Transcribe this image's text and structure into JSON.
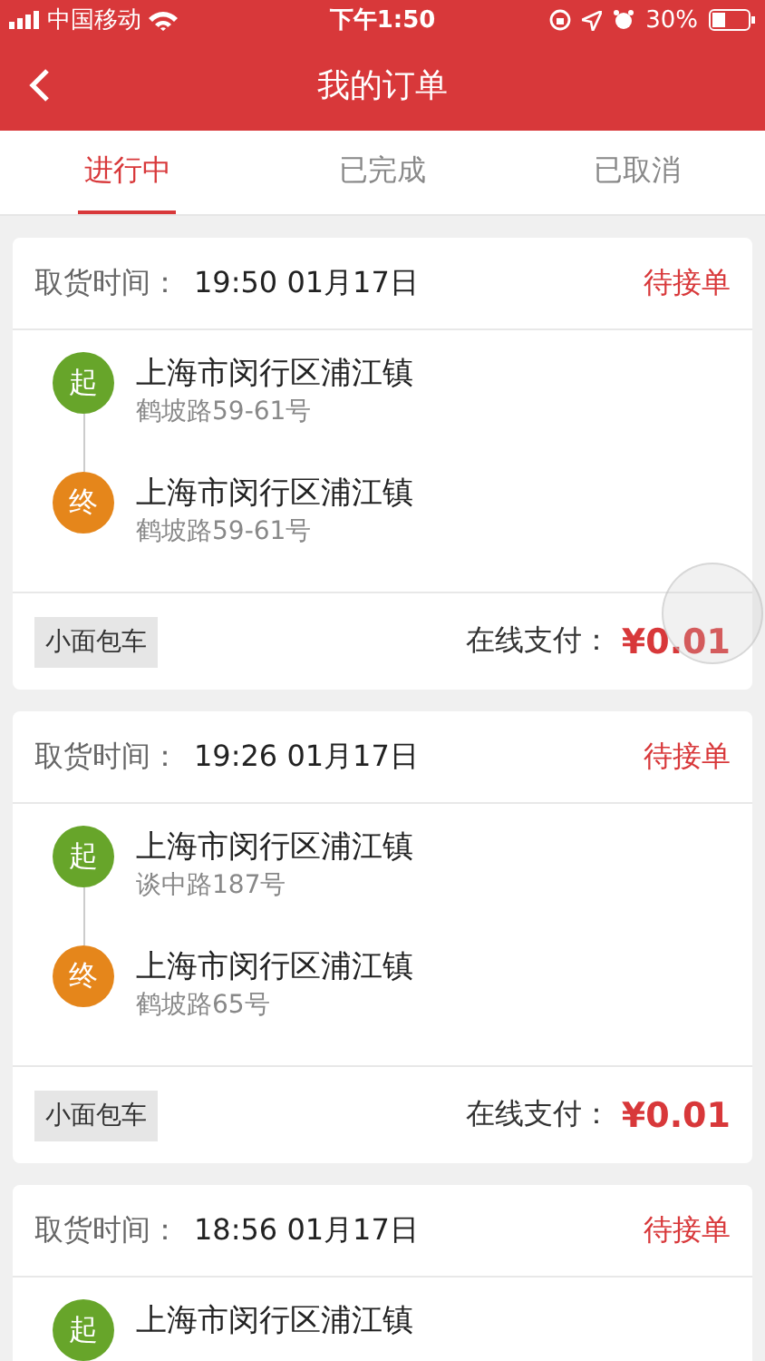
{
  "status_bar": {
    "carrier": "中国移动",
    "time": "下午1:50",
    "battery": "30%"
  },
  "nav": {
    "title": "我的订单"
  },
  "tabs": [
    {
      "label": "进行中",
      "selected": true
    },
    {
      "label": "已完成",
      "selected": false
    },
    {
      "label": "已取消",
      "selected": false
    }
  ],
  "orders": [
    {
      "pickup_label": "取货时间：",
      "pickup_time": "19:50 01月17日",
      "status": "待接单",
      "stops": [
        {
          "kind": "start",
          "marker": "起",
          "address": "上海市闵行区浦江镇",
          "detail": "鹤坡路59-61号"
        },
        {
          "kind": "end",
          "marker": "终",
          "address": "上海市闵行区浦江镇",
          "detail": "鹤坡路59-61号"
        }
      ],
      "vehicle": "小面包车",
      "payment_label": "在线支付：",
      "price": "¥0.01"
    },
    {
      "pickup_label": "取货时间：",
      "pickup_time": "19:26 01月17日",
      "status": "待接单",
      "stops": [
        {
          "kind": "start",
          "marker": "起",
          "address": "上海市闵行区浦江镇",
          "detail": "谈中路187号"
        },
        {
          "kind": "end",
          "marker": "终",
          "address": "上海市闵行区浦江镇",
          "detail": "鹤坡路65号"
        }
      ],
      "vehicle": "小面包车",
      "payment_label": "在线支付：",
      "price": "¥0.01"
    },
    {
      "pickup_label": "取货时间：",
      "pickup_time": "18:56 01月17日",
      "status": "待接单",
      "stops": [
        {
          "kind": "start",
          "marker": "起",
          "address": "上海市闵行区浦江镇"
        }
      ]
    }
  ]
}
